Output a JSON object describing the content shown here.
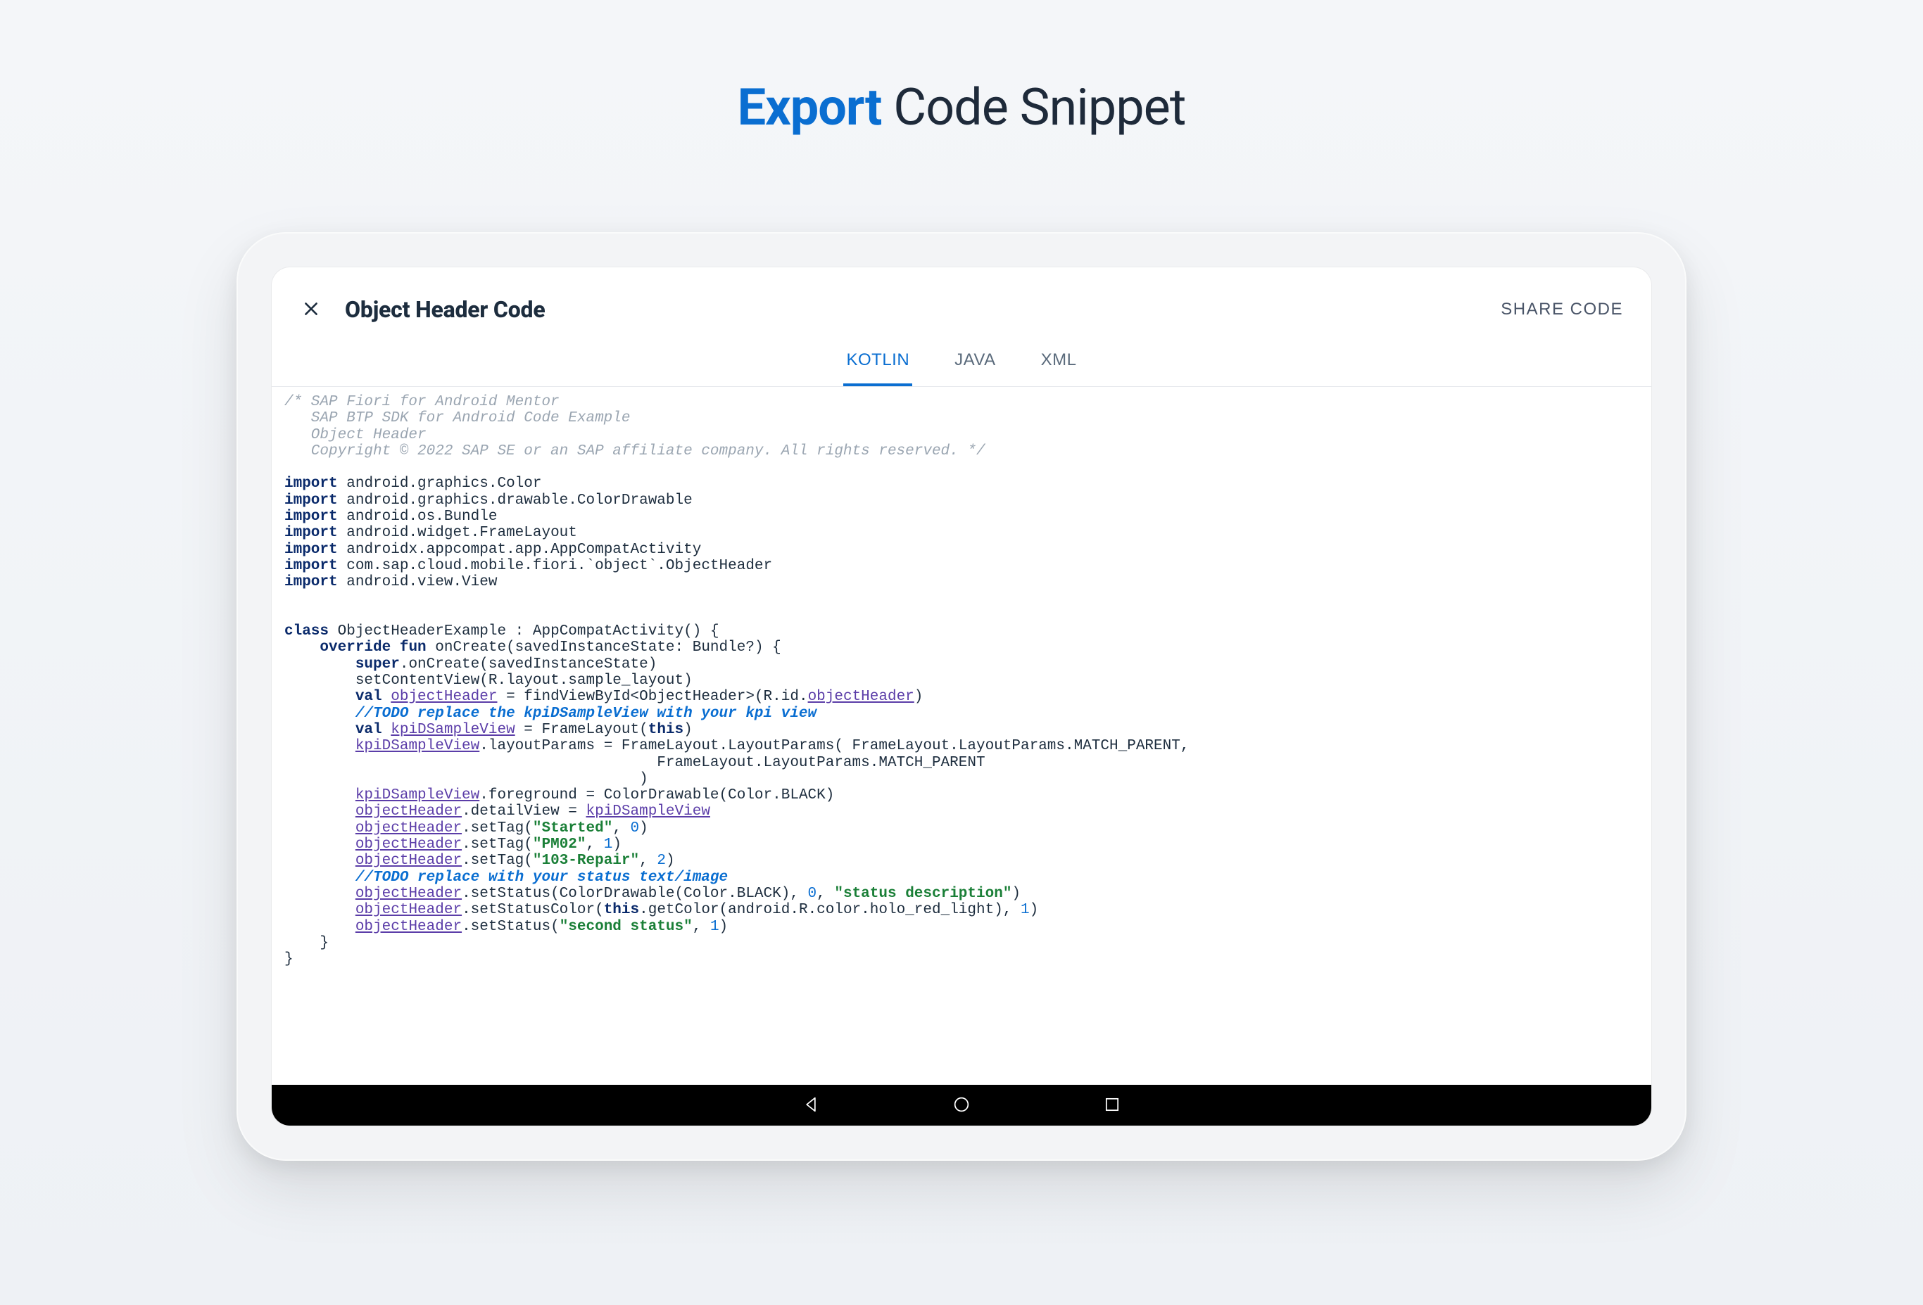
{
  "headline": {
    "accent": "Export",
    "rest": " Code Snippet"
  },
  "toolbar": {
    "title": "Object Header Code",
    "share_label": "SHARE CODE"
  },
  "tabs": {
    "kotlin": "KOTLIN",
    "java": "JAVA",
    "xml": "XML",
    "active": "kotlin"
  },
  "code": {
    "comment_block": "/* SAP Fiori for Android Mentor\n   SAP BTP SDK for Android Code Example\n   Object Header\n   Copyright © 2022 SAP SE or an SAP affiliate company. All rights reserved. */",
    "imports": [
      "android.graphics.Color",
      "android.graphics.drawable.ColorDrawable",
      "android.os.Bundle",
      "android.widget.FrameLayout",
      "androidx.appcompat.app.AppCompatActivity",
      "com.sap.cloud.mobile.fiori.`object`.ObjectHeader",
      "android.view.View"
    ],
    "class_name": "ObjectHeaderExample",
    "super_class": "AppCompatActivity",
    "fun_signature": "onCreate(savedInstanceState: Bundle?)",
    "super_call": ".onCreate(savedInstanceState)",
    "set_content_view": "setContentView(R.layout.sample_layout)",
    "find_view_mid": " = findViewById<ObjectHeader>(R.id.",
    "todo1": "//TODO replace the kpiDSampleView with your kpi view",
    "frame_layout_assign": " = FrameLayout(",
    "layout_params_line": ".layoutParams = FrameLayout.LayoutParams( FrameLayout.LayoutParams.MATCH_PARENT,",
    "layout_params_line2": "                                          FrameLayout.LayoutParams.MATCH_PARENT",
    "layout_params_close": "                                        )",
    "foreground_line": ".foreground = ColorDrawable(Color.BLACK)",
    "detail_view_line": ".detailView = ",
    "set_tag_prefix": ".setTag(",
    "tag1_str": "\"Started\"",
    "tag2_str": "\"PM02\"",
    "tag3_str": "\"103-Repair\"",
    "todo2": "//TODO replace with your status text/image",
    "set_status_prefix": ".setStatus(ColorDrawable(Color.BLACK), ",
    "status_desc_str": "\"status description\"",
    "set_status_color_mid": ".setStatusColor(",
    "get_color_mid": ".getColor(android.R.color.holo_red_light), ",
    "set_status2_prefix": ".setStatus(",
    "second_status_str": "\"second status\"",
    "id_objectHeader": "objectHeader",
    "id_kpiDSampleView": "kpiDSampleView",
    "kw_import": "import",
    "kw_class": "class",
    "kw_override_fun": "override fun",
    "kw_super": "super",
    "kw_val": "val",
    "kw_this": "this",
    "n0": "0",
    "n1": "1",
    "n2": "2"
  }
}
